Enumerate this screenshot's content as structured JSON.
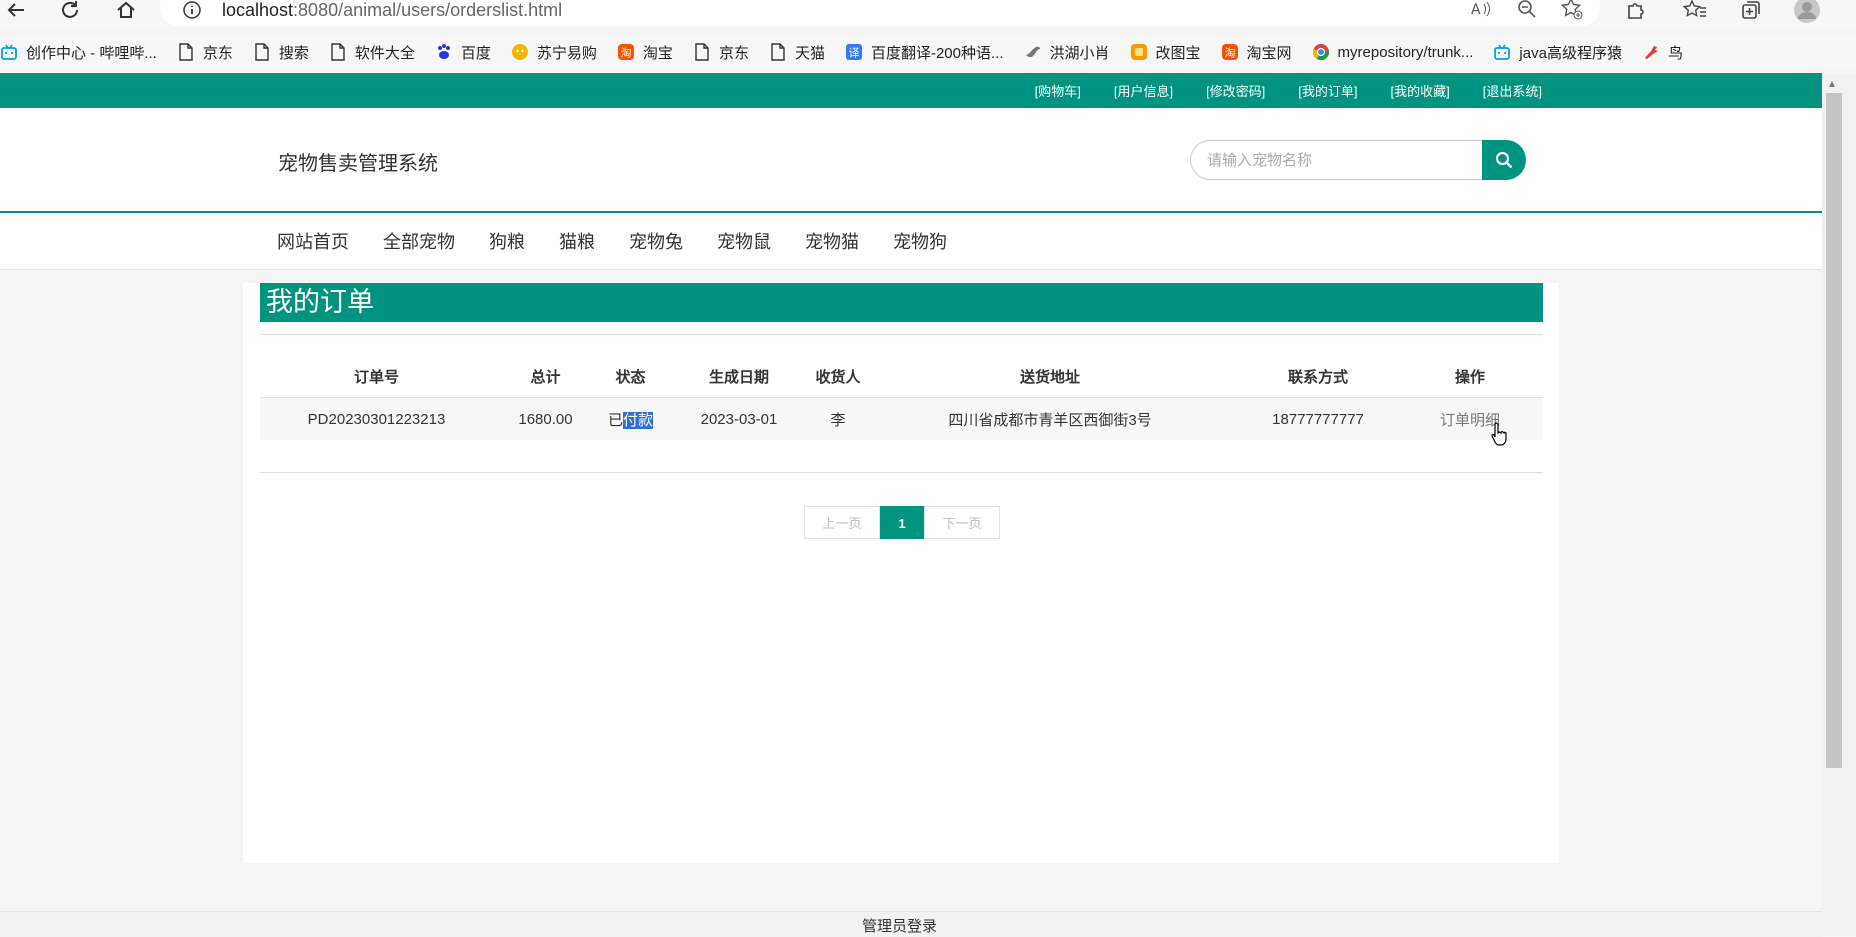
{
  "browser": {
    "url_host": "localhost",
    "url_path": ":8080/animal/users/orderslist.html",
    "bookmarks": [
      {
        "label": "创作中心 - 哔哩哔...",
        "icon": "bilibili-icon"
      },
      {
        "label": "京东",
        "icon": "page-icon"
      },
      {
        "label": "搜索",
        "icon": "page-icon"
      },
      {
        "label": "软件大全",
        "icon": "page-icon"
      },
      {
        "label": "百度",
        "icon": "baidu-icon"
      },
      {
        "label": "苏宁易购",
        "icon": "suning-icon"
      },
      {
        "label": "淘宝",
        "icon": "taobao-icon"
      },
      {
        "label": "京东",
        "icon": "page-icon"
      },
      {
        "label": "天猫",
        "icon": "page-icon"
      },
      {
        "label": "百度翻译-200种语...",
        "icon": "translate-icon"
      },
      {
        "label": "洪湖小肖",
        "icon": "bird-icon"
      },
      {
        "label": "改图宝",
        "icon": "image-edit-icon"
      },
      {
        "label": "淘宝网",
        "icon": "taobao-icon"
      },
      {
        "label": "myrepository/trunk...",
        "icon": "chrome-icon"
      },
      {
        "label": "java高级程序猿",
        "icon": "bilibili-icon"
      },
      {
        "label": "鸟",
        "icon": "bird-red-icon"
      }
    ]
  },
  "topbar": {
    "links": [
      "[购物车]",
      "[用户信息]",
      "[修改密码]",
      "[我的订单]",
      "[我的收藏]",
      "[退出系统]"
    ]
  },
  "header": {
    "site_title": "宠物售卖管理系统",
    "search_placeholder": "请输入宠物名称"
  },
  "nav": {
    "items": [
      "网站首页",
      "全部宠物",
      "狗粮",
      "猫粮",
      "宠物兔",
      "宠物鼠",
      "宠物猫",
      "宠物狗"
    ]
  },
  "orders": {
    "title": "我的订单",
    "columns": [
      "订单号",
      "总计",
      "状态",
      "生成日期",
      "收货人",
      "送货地址",
      "联系方式",
      "操作"
    ],
    "rows": [
      {
        "order_no": "PD20230301223213",
        "total": "1680.00",
        "status_prefix": "已",
        "status_selected": "付款",
        "date": "2023-03-01",
        "receiver": "李",
        "address": "四川省成都市青羊区西御街3号",
        "phone": "18777777777",
        "action": "订单明细"
      }
    ]
  },
  "pager": {
    "prev": "上一页",
    "current": "1",
    "next": "下一页"
  },
  "footer": {
    "admin_login": "管理员登录"
  },
  "colors": {
    "brand": "#009480",
    "selection": "#2f6fd6"
  }
}
